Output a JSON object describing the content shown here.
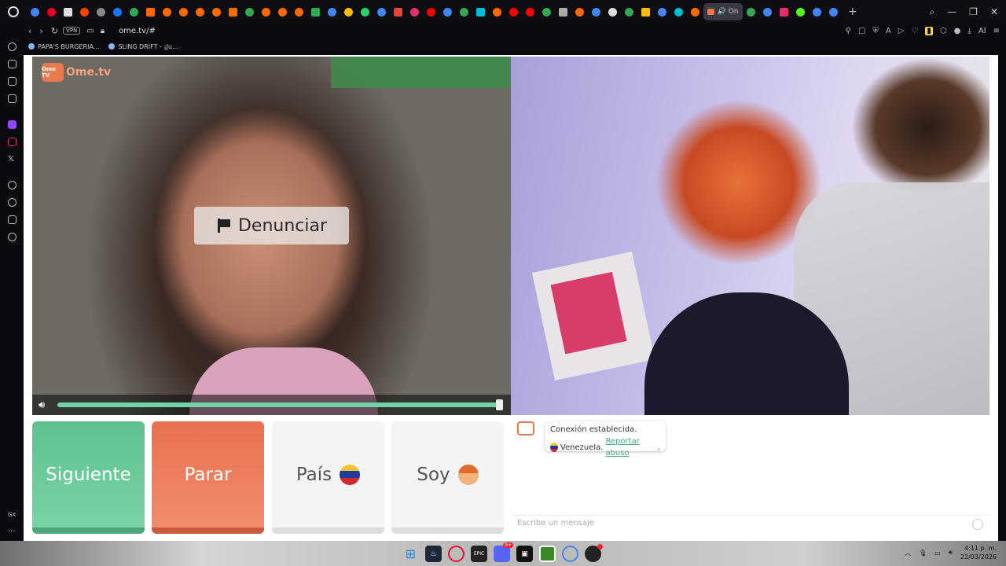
{
  "browser": {
    "active_tab_label": "On",
    "url": "ome.tv/#",
    "vpn_label": "VPN",
    "ai_label": "AI",
    "tab_favicons": [
      "#4285f4",
      "#e60023",
      "#ddd",
      "#ff4500",
      "#888",
      "#1877f2",
      "#34a853",
      "#ff6a00",
      "#ff6a00",
      "#ff6a00",
      "#ff6a00",
      "#ff6a00",
      "#ff6a00",
      "#34a853",
      "#ff6a00",
      "#ff6a00",
      "#ff6a00",
      "#34a853",
      "#4285f4",
      "#fbbc05",
      "#25d366",
      "#4285f4",
      "#ea4335",
      "#e1306c",
      "#ff0000",
      "#4285f4",
      "#34a853",
      "#00bcd4",
      "#ff6a00",
      "#ff0000",
      "#ff0000",
      "#34a853",
      "#aaa",
      "#ff6a00",
      "#4285f4",
      "#ddd",
      "#34a853",
      "#fbbc05",
      "#4285f4",
      "#00bcd4",
      "#ff6a00"
    ],
    "right_favicons": [
      "#34a853",
      "#4285f4",
      "#e1306c",
      "#53fc18",
      "#4285f4",
      "#4285f4"
    ]
  },
  "bookmarks": [
    {
      "label": "PAPA'S BURGERIA..."
    },
    {
      "label": "SLING DRIFT - ¡Ju..."
    }
  ],
  "sidebar": {
    "gx_label": "GX",
    "more_label": "..."
  },
  "ometv": {
    "logo_badge": "Ome TV",
    "logo_text": "Ome.tv",
    "report_label": "Denunciar",
    "buttons": {
      "next": "Siguiente",
      "stop": "Parar",
      "country": "País",
      "gender": "Soy"
    },
    "chat": {
      "connected": "Conexión establecida.",
      "country": "Venezuela.",
      "report_abuse": "Reportar abuso",
      "period": ".",
      "placeholder": "Escribe un mensaje"
    },
    "volume": 1.0,
    "colors": {
      "next": "#6dcb9b",
      "stop": "#ec7b5c",
      "accent": "#6fd3aa"
    }
  },
  "taskbar": {
    "time": "4:11 p. m.",
    "date": "22/03/2026",
    "discord_badge": "9+",
    "epic_label": "EPIC"
  }
}
